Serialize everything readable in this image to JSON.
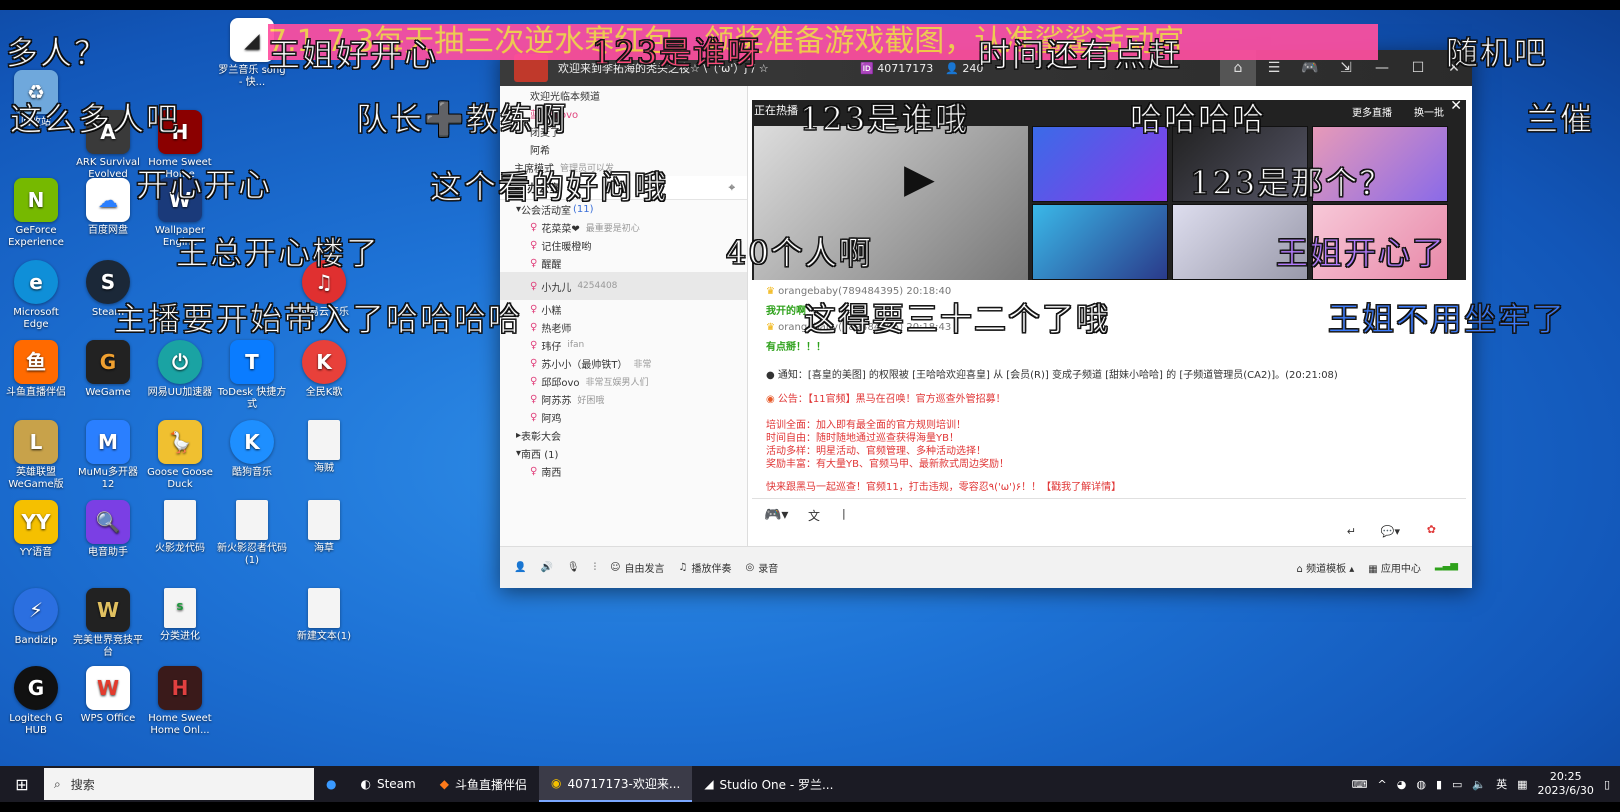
{
  "desktop_icons": [
    {
      "label": "回收站",
      "color": "#6fa8dc"
    },
    {
      "label": "ARK Survival Evolved",
      "color": "#3a3a3a"
    },
    {
      "label": "Home Sweet Home",
      "color": "#8b0000"
    },
    {
      "label": "罗兰音乐 song - 快...",
      "color": "#222"
    },
    {
      "label": "GeForce Experience",
      "color": "#76b900"
    },
    {
      "label": "百度网盘",
      "color": "#2a7fff"
    },
    {
      "label": "Wallpaper Engine",
      "color": "#1a3a7a"
    },
    {
      "label": "Microsoft Edge",
      "color": "#0f8fd8"
    },
    {
      "label": "Steam",
      "color": "#1b2838"
    },
    {
      "label": "网易云音乐",
      "color": "#e03030"
    },
    {
      "label": "斗鱼直播伴侣",
      "color": "#ff6a00"
    },
    {
      "label": "WeGame",
      "color": "#222"
    },
    {
      "label": "网易UU加速器",
      "color": "#1aa3a3"
    },
    {
      "label": "ToDesk 快捷方式",
      "color": "#0a7cff"
    },
    {
      "label": "全民K歌",
      "color": "#e8403a"
    },
    {
      "label": "英雄联盟 WeGame版",
      "color": "#c8a24a"
    },
    {
      "label": "MuMu多开器12",
      "color": "#2a7fff"
    },
    {
      "label": "Goose Goose Duck",
      "color": "#f0c030"
    },
    {
      "label": "酷狗音乐",
      "color": "#1e8fff"
    },
    {
      "label": "海贼",
      "color": "#f4f4f4"
    },
    {
      "label": "YY语音",
      "color": "#f5c000"
    },
    {
      "label": "电音助手",
      "color": "#7b3fe4"
    },
    {
      "label": "火影龙代码",
      "color": "#f4f4f4"
    },
    {
      "label": "新火影忍者代码(1)",
      "color": "#f4f4f4"
    },
    {
      "label": "海草",
      "color": "#f4f4f4"
    },
    {
      "label": "Bandizip",
      "color": "#2b6fe0"
    },
    {
      "label": "完美世界竞技平台",
      "color": "#222"
    },
    {
      "label": "分类进化",
      "color": "#f4f4f4"
    },
    {
      "label": "新建文本(1)",
      "color": "#f4f4f4"
    },
    {
      "label": "Logitech G HUB",
      "color": "#111"
    },
    {
      "label": "WPS Office",
      "color": "#e23b2e"
    },
    {
      "label": "Home Sweet Home Onl...",
      "color": "#3a1a1a"
    }
  ],
  "banner": "7.1-7.3每天抽三次逆水寒红包，领奖准备游戏截图，认准鲨鲨活动官",
  "danmaku": [
    "多人？",
    "王姐好开心",
    "123是谁呀",
    "时间还有点赶",
    "随机吧",
    "这么多人吧",
    "队长➕教练啊",
    "123是谁哦",
    "哈哈哈哈",
    "兰催",
    "开心开心",
    "这个看的好闷哦",
    "123是那个？",
    "王总开心楼了",
    "40个人啊",
    "王姐开心了",
    "主播要开始带入了哈哈哈哈",
    "这得要三十二个了哦",
    "王姐不用坐牢了"
  ],
  "window": {
    "title": "欢迎来到李拓海的秃头之夜☆ \\（'ω'）ʃ / ☆",
    "room_id": "40717173",
    "members": "240",
    "left_panel": {
      "top_items": [
        "欢迎光临本频道",
        "蓝泽泽ovo",
        "闭麦了",
        "阿希"
      ],
      "mode_label": "主席模式",
      "mode_hint": "管理员可以发",
      "section": "办公室",
      "groups": [
        {
          "name": "公会活动室",
          "count": "(11)"
        }
      ],
      "users": [
        {
          "name": "花菜菜❤",
          "note": "最重要是初心"
        },
        {
          "name": "记住暖橙哟",
          "note": ""
        },
        {
          "name": "醒醒",
          "note": ""
        },
        {
          "name": "小九儿",
          "note": "4254408"
        },
        {
          "name": "小糕",
          "note": ""
        },
        {
          "name": "热老师",
          "note": ""
        },
        {
          "name": "玮仔",
          "note": "ifan"
        },
        {
          "name": "苏小小（最帅铁T）",
          "note": "非常"
        },
        {
          "name": "邱邱ovo",
          "note": "非常互娱男人们"
        },
        {
          "name": "阿苏苏",
          "note": "好困哦"
        },
        {
          "name": "阿鸡",
          "note": ""
        }
      ],
      "subgroups": [
        "表彰大会",
        "南西 (1)"
      ],
      "subusers": [
        "南西"
      ]
    },
    "live_label": "正在热播",
    "more_live": "更多直播",
    "switch_batch": "换一批",
    "chat": {
      "user1": "orangebaby(789484395)",
      "time1": "20:18:40",
      "msg1": "我开的啊",
      "user2": "orangebaby(789484395)",
      "time2": "20:18:43",
      "msg2": "有点掰！！！",
      "notice": "通知：[喜皇的美图] 的权限被 [王哈哈欢迎喜皇] 从 [会员(R)] 变成子频道 [甜妹小哈哈] 的 [子频道管理员(CA2)]。(20:21:08)",
      "announce": "公告：【11官频】黑马在召唤！官方巡查外管招募！",
      "lines": [
        "培训全面：加入即有最全面的官方规则培训！",
        "时间自由：随时随地通过巡查获得海量YB！",
        "活动多样：明星活动、官频管理、多种活动选择！",
        "奖励丰富：有大量YB、官频马甲、最新款式周边奖励！"
      ],
      "cta": "快来跟黑马一起巡查！官频11，打击违规，零容忍٩('ω')۶！！【戳我了解详情】"
    },
    "bottom": [
      "自由发言",
      "播放伴奏",
      "录音"
    ],
    "bottom_right": [
      "频道模板",
      "应用中心"
    ]
  },
  "taskbar": {
    "search_placeholder": "搜索",
    "items": [
      "Steam",
      "斗鱼直播伴侣",
      "40717173-欢迎来...",
      "Studio One - 罗兰..."
    ],
    "lang": "英",
    "time": "20:25",
    "date": "2023/6/30"
  }
}
